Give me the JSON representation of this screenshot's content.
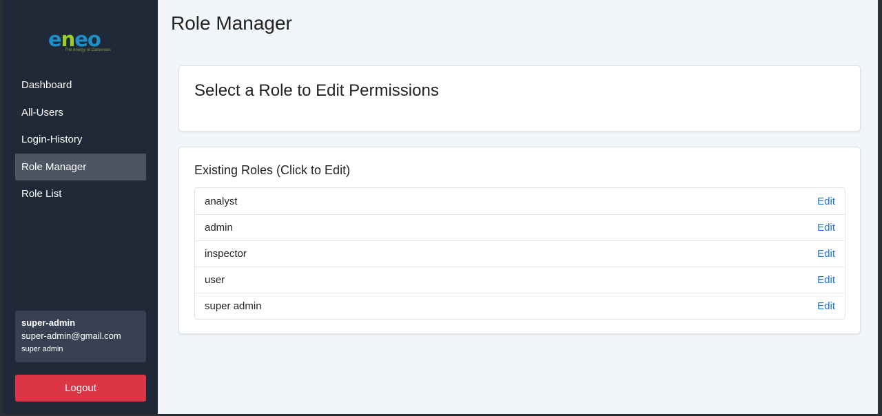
{
  "brand": {
    "logo_part1": "e",
    "logo_part2": "n",
    "logo_part3": "eo",
    "tagline": "The energy of Cameroon"
  },
  "sidebar": {
    "items": [
      {
        "label": "Dashboard",
        "active": false
      },
      {
        "label": "All-Users",
        "active": false
      },
      {
        "label": "Login-History",
        "active": false
      },
      {
        "label": "Role Manager",
        "active": true
      },
      {
        "label": "Role List",
        "active": false
      }
    ]
  },
  "user": {
    "name": "super-admin",
    "email": "super-admin@gmail.com",
    "role": "super admin"
  },
  "logout_label": "Logout",
  "page": {
    "title": "Role Manager",
    "select_heading": "Select a Role to Edit Permissions",
    "roles_heading": "Existing Roles (Click to Edit)"
  },
  "roles": [
    {
      "name": "analyst",
      "action": "Edit"
    },
    {
      "name": "admin",
      "action": "Edit"
    },
    {
      "name": "inspector",
      "action": "Edit"
    },
    {
      "name": "user",
      "action": "Edit"
    },
    {
      "name": "super admin",
      "action": "Edit"
    }
  ],
  "colors": {
    "sidebar_bg": "#1f2937",
    "active_item_bg": "#4b5563",
    "logout_bg": "#dc3545",
    "link": "#1a73e8",
    "logo_blue": "#1f8fc9",
    "logo_green": "#9ccd2a"
  }
}
